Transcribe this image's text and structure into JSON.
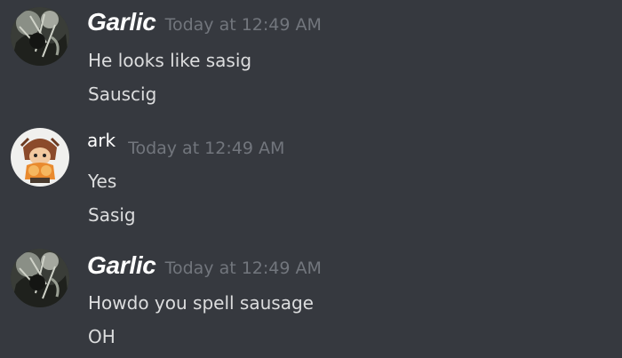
{
  "messages": [
    {
      "author": "Garlic",
      "timestamp": "Today at 12:49 AM",
      "lines": [
        "He looks like sasig",
        "Sauscig"
      ],
      "avatar_icon": "dark-foliage-avatar"
    },
    {
      "author": "ark",
      "timestamp": "Today at 12:49 AM",
      "lines": [
        "Yes",
        "Sasig"
      ],
      "avatar_icon": "cartoon-character-avatar"
    },
    {
      "author": "Garlic",
      "timestamp": "Today at 12:49 AM",
      "lines": [
        "Howdo you spell sausage",
        "OH"
      ],
      "avatar_icon": "dark-foliage-avatar"
    }
  ],
  "colors": {
    "background": "#36393f",
    "username": "#ffffff",
    "timestamp": "#72767d",
    "message_text": "#dcddde"
  }
}
